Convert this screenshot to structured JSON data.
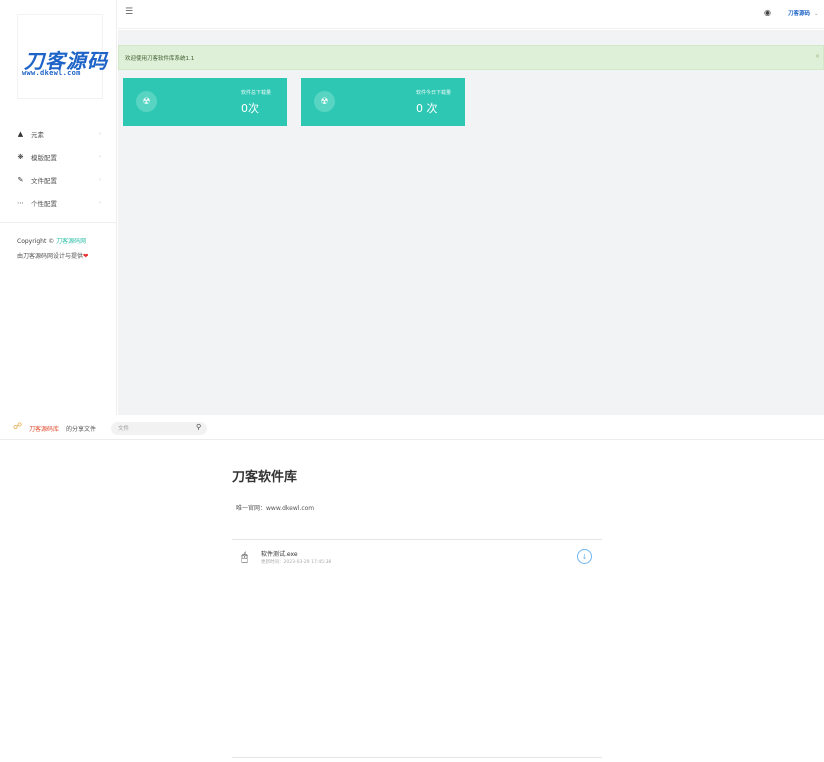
{
  "admin": {
    "logo": {
      "main": "刀客源码",
      "sub": "www.dkewl.com"
    },
    "menu": [
      {
        "label": "元素",
        "icon": "home-icon"
      },
      {
        "label": "模版配置",
        "icon": "gear-icon"
      },
      {
        "label": "文件配置",
        "icon": "pencil-icon"
      },
      {
        "label": "个性配置",
        "icon": "ellipsis-icon"
      }
    ],
    "copyright": {
      "prefix": "Copyright © ",
      "link": "刀客源码网"
    },
    "credit": {
      "text": "由刀客源码网设计与提供",
      "heart": "❤"
    },
    "topbar": {
      "user": "刀客源码",
      "caret": "⌄"
    },
    "notice": {
      "text": "欢迎使用刀客软件库系统1.1",
      "close": "×"
    },
    "stats": [
      {
        "label": "软件总下载量",
        "value": "0次"
      },
      {
        "label": "软件今日下载量",
        "value": "0 次"
      }
    ]
  },
  "share": {
    "brand": "刀客源码库",
    "suffix": "的分享文件",
    "search_placeholder": "文件",
    "title": "刀客软件库",
    "description": "唯一官网：www.dkewl.com",
    "files": [
      {
        "name": "软件测试.exe",
        "meta": "更新时间：2023-03-29 17:45:38"
      }
    ]
  }
}
